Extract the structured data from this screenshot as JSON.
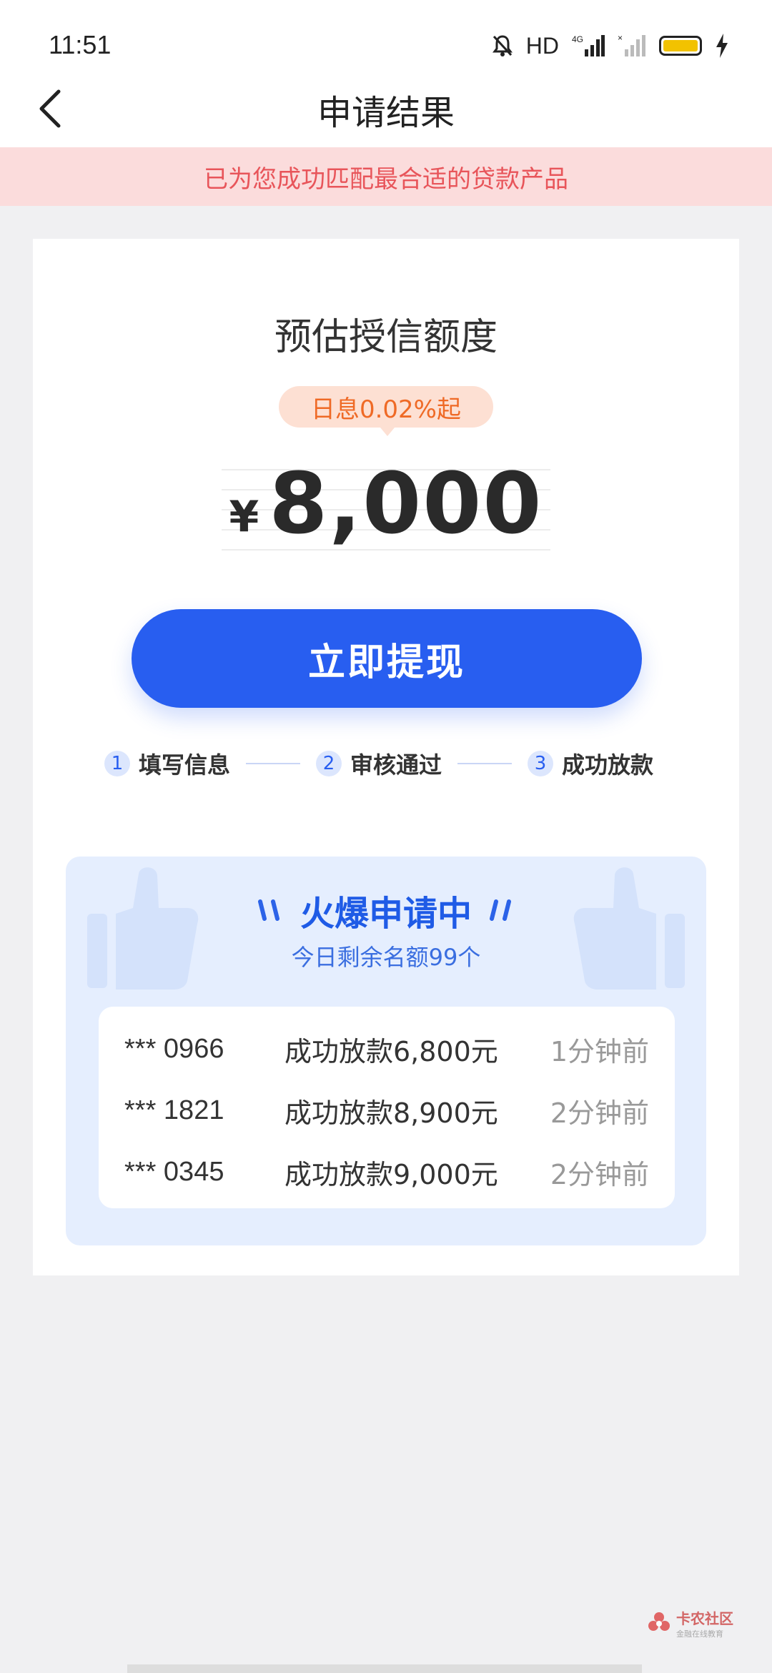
{
  "status_bar": {
    "time": "11:51",
    "network": "HD",
    "icons": [
      "mute-bell-icon",
      "hd-icon",
      "signal-4g-icon",
      "signal-no-sim-icon",
      "battery-icon",
      "charging-icon"
    ],
    "battery_color": "#f2c200"
  },
  "header": {
    "title": "申请结果",
    "back_icon": "chevron-left-icon"
  },
  "notice": {
    "text": "已为您成功匹配最合适的贷款产品"
  },
  "quota": {
    "title": "预估授信额度",
    "rate_badge": "日息0.02%起",
    "currency": "¥",
    "amount": "8,000"
  },
  "withdraw_button": {
    "label": "立即提现"
  },
  "steps": [
    {
      "num": "1",
      "label": "填写信息"
    },
    {
      "num": "2",
      "label": "审核通过"
    },
    {
      "num": "3",
      "label": "成功放款"
    }
  ],
  "popular": {
    "title": "火爆申请中",
    "subtitle": "今日剩余名额99个",
    "records": [
      {
        "phone": "*** 0966",
        "desc": "成功放款6,800元",
        "time": "1分钟前"
      },
      {
        "phone": "*** 1821",
        "desc": "成功放款8,900元",
        "time": "2分钟前"
      },
      {
        "phone": "*** 0345",
        "desc": "成功放款9,000元",
        "time": "2分钟前"
      }
    ]
  },
  "watermark": {
    "title": "卡农社区",
    "subtitle": "金融在线教育"
  },
  "colors": {
    "primary": "#285ef0",
    "notice_bg": "#fbdcdc",
    "notice_text": "#e8555a",
    "badge_text": "#ef6a26"
  }
}
